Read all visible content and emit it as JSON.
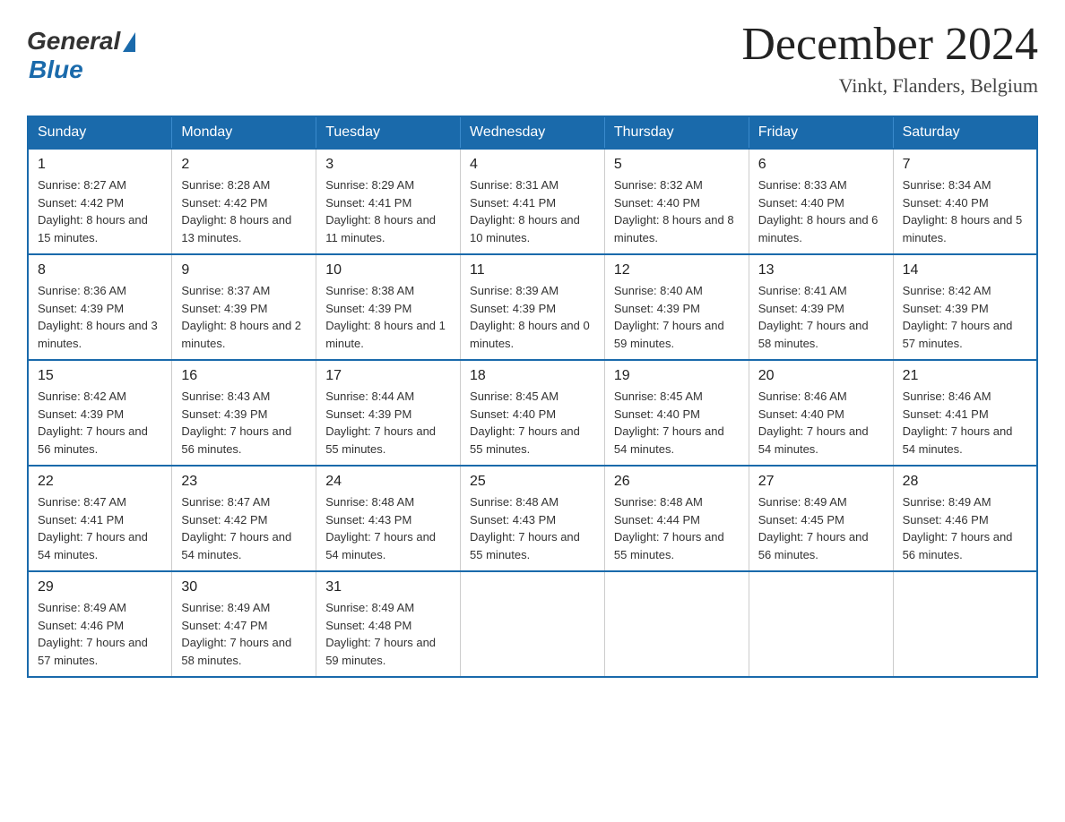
{
  "logo": {
    "general": "General",
    "blue": "Blue"
  },
  "header": {
    "month_title": "December 2024",
    "location": "Vinkt, Flanders, Belgium"
  },
  "days_of_week": [
    "Sunday",
    "Monday",
    "Tuesday",
    "Wednesday",
    "Thursday",
    "Friday",
    "Saturday"
  ],
  "weeks": [
    [
      {
        "day": "1",
        "sunrise": "8:27 AM",
        "sunset": "4:42 PM",
        "daylight": "8 hours and 15 minutes."
      },
      {
        "day": "2",
        "sunrise": "8:28 AM",
        "sunset": "4:42 PM",
        "daylight": "8 hours and 13 minutes."
      },
      {
        "day": "3",
        "sunrise": "8:29 AM",
        "sunset": "4:41 PM",
        "daylight": "8 hours and 11 minutes."
      },
      {
        "day": "4",
        "sunrise": "8:31 AM",
        "sunset": "4:41 PM",
        "daylight": "8 hours and 10 minutes."
      },
      {
        "day": "5",
        "sunrise": "8:32 AM",
        "sunset": "4:40 PM",
        "daylight": "8 hours and 8 minutes."
      },
      {
        "day": "6",
        "sunrise": "8:33 AM",
        "sunset": "4:40 PM",
        "daylight": "8 hours and 6 minutes."
      },
      {
        "day": "7",
        "sunrise": "8:34 AM",
        "sunset": "4:40 PM",
        "daylight": "8 hours and 5 minutes."
      }
    ],
    [
      {
        "day": "8",
        "sunrise": "8:36 AM",
        "sunset": "4:39 PM",
        "daylight": "8 hours and 3 minutes."
      },
      {
        "day": "9",
        "sunrise": "8:37 AM",
        "sunset": "4:39 PM",
        "daylight": "8 hours and 2 minutes."
      },
      {
        "day": "10",
        "sunrise": "8:38 AM",
        "sunset": "4:39 PM",
        "daylight": "8 hours and 1 minute."
      },
      {
        "day": "11",
        "sunrise": "8:39 AM",
        "sunset": "4:39 PM",
        "daylight": "8 hours and 0 minutes."
      },
      {
        "day": "12",
        "sunrise": "8:40 AM",
        "sunset": "4:39 PM",
        "daylight": "7 hours and 59 minutes."
      },
      {
        "day": "13",
        "sunrise": "8:41 AM",
        "sunset": "4:39 PM",
        "daylight": "7 hours and 58 minutes."
      },
      {
        "day": "14",
        "sunrise": "8:42 AM",
        "sunset": "4:39 PM",
        "daylight": "7 hours and 57 minutes."
      }
    ],
    [
      {
        "day": "15",
        "sunrise": "8:42 AM",
        "sunset": "4:39 PM",
        "daylight": "7 hours and 56 minutes."
      },
      {
        "day": "16",
        "sunrise": "8:43 AM",
        "sunset": "4:39 PM",
        "daylight": "7 hours and 56 minutes."
      },
      {
        "day": "17",
        "sunrise": "8:44 AM",
        "sunset": "4:39 PM",
        "daylight": "7 hours and 55 minutes."
      },
      {
        "day": "18",
        "sunrise": "8:45 AM",
        "sunset": "4:40 PM",
        "daylight": "7 hours and 55 minutes."
      },
      {
        "day": "19",
        "sunrise": "8:45 AM",
        "sunset": "4:40 PM",
        "daylight": "7 hours and 54 minutes."
      },
      {
        "day": "20",
        "sunrise": "8:46 AM",
        "sunset": "4:40 PM",
        "daylight": "7 hours and 54 minutes."
      },
      {
        "day": "21",
        "sunrise": "8:46 AM",
        "sunset": "4:41 PM",
        "daylight": "7 hours and 54 minutes."
      }
    ],
    [
      {
        "day": "22",
        "sunrise": "8:47 AM",
        "sunset": "4:41 PM",
        "daylight": "7 hours and 54 minutes."
      },
      {
        "day": "23",
        "sunrise": "8:47 AM",
        "sunset": "4:42 PM",
        "daylight": "7 hours and 54 minutes."
      },
      {
        "day": "24",
        "sunrise": "8:48 AM",
        "sunset": "4:43 PM",
        "daylight": "7 hours and 54 minutes."
      },
      {
        "day": "25",
        "sunrise": "8:48 AM",
        "sunset": "4:43 PM",
        "daylight": "7 hours and 55 minutes."
      },
      {
        "day": "26",
        "sunrise": "8:48 AM",
        "sunset": "4:44 PM",
        "daylight": "7 hours and 55 minutes."
      },
      {
        "day": "27",
        "sunrise": "8:49 AM",
        "sunset": "4:45 PM",
        "daylight": "7 hours and 56 minutes."
      },
      {
        "day": "28",
        "sunrise": "8:49 AM",
        "sunset": "4:46 PM",
        "daylight": "7 hours and 56 minutes."
      }
    ],
    [
      {
        "day": "29",
        "sunrise": "8:49 AM",
        "sunset": "4:46 PM",
        "daylight": "7 hours and 57 minutes."
      },
      {
        "day": "30",
        "sunrise": "8:49 AM",
        "sunset": "4:47 PM",
        "daylight": "7 hours and 58 minutes."
      },
      {
        "day": "31",
        "sunrise": "8:49 AM",
        "sunset": "4:48 PM",
        "daylight": "7 hours and 59 minutes."
      },
      null,
      null,
      null,
      null
    ]
  ]
}
